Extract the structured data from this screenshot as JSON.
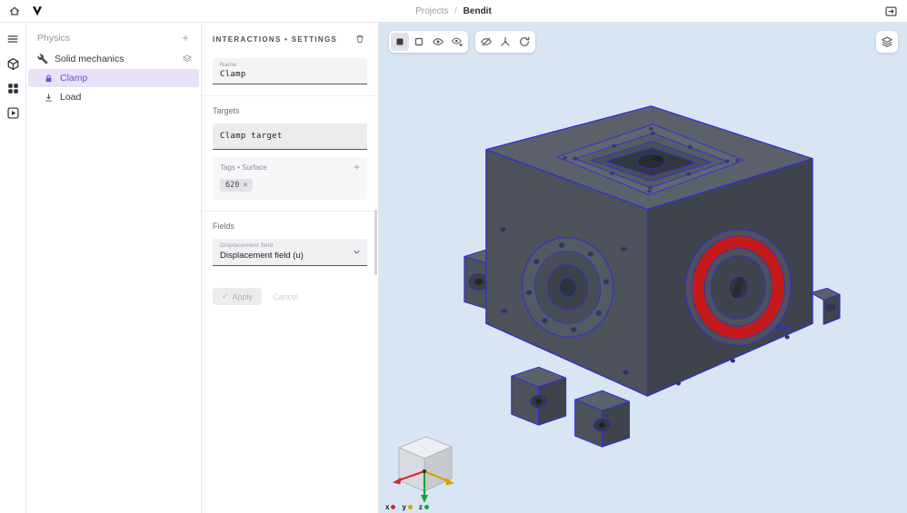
{
  "topbar": {
    "breadcrumb": {
      "parent": "Projects",
      "separator": "/",
      "current": "Bendit"
    }
  },
  "physics_panel": {
    "title": "Physics",
    "add_button": "+",
    "tree": [
      {
        "label": "Solid mechanics"
      },
      {
        "label": "Clamp"
      },
      {
        "label": "Load"
      }
    ]
  },
  "settings_panel": {
    "header": "INTERACTIONS • SETTINGS",
    "name_field": {
      "label": "Name",
      "value": "Clamp"
    },
    "targets": {
      "label": "Targets",
      "value": "Clamp target",
      "tags_label": "Tags • Surface",
      "tags_add": "+",
      "chip": {
        "value": "620",
        "remove": "×"
      }
    },
    "fields": {
      "label": "Fields",
      "dropdown_label": "Displacement field",
      "dropdown_value": "Displacement field (u)"
    },
    "actions": {
      "apply_check": "✓",
      "apply": "Apply",
      "cancel": "Cancel"
    }
  },
  "viewport": {
    "model_label": "MEET",
    "axes": [
      {
        "label": "x"
      },
      {
        "label": "y"
      },
      {
        "label": "z"
      }
    ]
  },
  "colors": {
    "accent_purple": "#6d4fd4",
    "selection_bg": "#e8e1f8",
    "viewport_bg": "#d8e6f4",
    "model_edge": "#2d2dd6",
    "model_red": "#c41a1a",
    "model_top": "#5c6169",
    "model_left": "#4c515a",
    "model_right": "#3f444c",
    "axis_x": "#d32b2b",
    "axis_y": "#d6a300",
    "axis_z": "#18a33c"
  }
}
